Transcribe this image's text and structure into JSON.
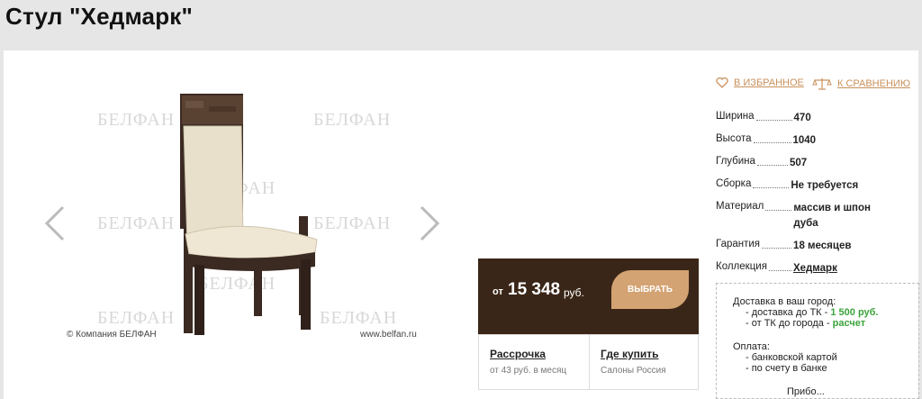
{
  "page_title": "Стул \"Хедмарк\"",
  "gallery": {
    "watermark": "БЕЛФАН",
    "copyright": "© Компания БЕЛФАН",
    "site": "www.belfan.ru"
  },
  "actions": {
    "favorites": "В ИЗБРАННОЕ",
    "compare": "К СРАВНЕНИЮ"
  },
  "specs": [
    {
      "label": "Ширина",
      "value": "470"
    },
    {
      "label": "Высота",
      "value": "1040"
    },
    {
      "label": "Глубина",
      "value": "507"
    },
    {
      "label": "Сборка",
      "value": "Не требуется"
    },
    {
      "label": "Материал",
      "value": "массив и шпон дуба"
    },
    {
      "label": "Гарантия",
      "value": "18 месяцев"
    },
    {
      "label": "Коллекция",
      "value": "Хедмарк"
    }
  ],
  "price": {
    "prefix": "от",
    "value": "15 348",
    "currency": "руб.",
    "button": "ВЫБРАТЬ"
  },
  "installment": {
    "title": "Рассрочка",
    "text": "от 43 руб. в месяц"
  },
  "where_buy": {
    "title": "Где купить",
    "text": "Салоны Россия"
  },
  "delivery": {
    "heading": "Доставка в ваш город:",
    "line1_prefix": "- доставка до ТК - ",
    "line1_value": "1 500 руб.",
    "line2_prefix": "- от ТК до города - ",
    "line2_value": "расчет",
    "payment_heading": "Оплата:",
    "pay1": "- банковской картой",
    "pay2": "- по счету в банке",
    "cut_text": "Прибо..."
  },
  "colors": {
    "accent": "#c9905b",
    "price_bg": "#3a2618",
    "button_bg": "#d4a373",
    "green": "#3aa33a"
  }
}
